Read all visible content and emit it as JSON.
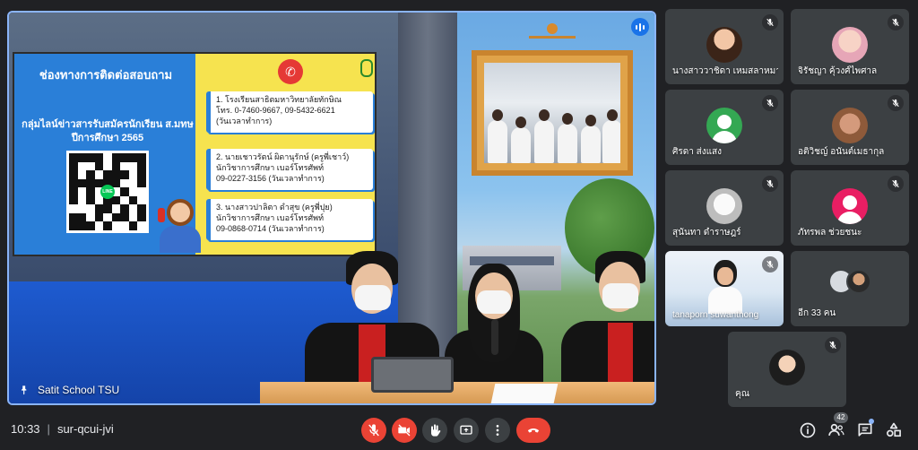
{
  "main_tile": {
    "name": "Satit School TSU",
    "poster": {
      "title": "ช่องทางการติดต่อสอบถาม",
      "subtitle": "กลุ่มไลน์ข่าวสารรับสมัครนักเรียน ส.มทษ ปีการศึกษา 2565",
      "contacts": [
        {
          "line1": "1. โรงเรียนสาธิตมหาวิทยาลัยทักษิณ",
          "line2": "โทร. 0-7460-9667, 09-5432-6621",
          "line3": "(วันเวลาทำการ)"
        },
        {
          "line1": "2. นายเชาวรัตน์ ผิดานุรักษ์ (ครูพี่เชาว์)",
          "line2": "นักวิชาการศึกษา เบอร์โทรศัพท์",
          "line3": "09-0227-3156 (วันเวลาทำการ)"
        },
        {
          "line1": "3. นางสาวปาลิตา ดำสุข (ครูพี่ปุย)",
          "line2": "นักวิชาการศึกษา เบอร์โทรศัพท์",
          "line3": "09-0868-0714 (วันเวลาทำการ)"
        }
      ]
    }
  },
  "participants": [
    {
      "name": "นางสาววาชิดา เหมสลาหมาด",
      "avatar": "photo1",
      "muted": true
    },
    {
      "name": "จิรัชญา คุ้วงศ์ไพศาล",
      "avatar": "photo2",
      "muted": true
    },
    {
      "name": "ศิรดา ส่งแสง",
      "avatar": "green",
      "muted": true
    },
    {
      "name": "อติวิชญ์ อนันต์เมธากุล",
      "avatar": "photo3",
      "muted": true
    },
    {
      "name": "สุนันทา ดำราษฎร์",
      "avatar": "photo4",
      "muted": true
    },
    {
      "name": "ภัทรพล ช่วยชนะ",
      "avatar": "pink",
      "muted": true
    },
    {
      "name": "tanaporn suwanthong",
      "avatar": "video",
      "muted": true
    },
    {
      "name": "อีก 33 คน",
      "avatar": "group",
      "muted": false
    },
    {
      "name": "คุณ",
      "avatar": "photo5",
      "muted": true
    }
  ],
  "bottombar": {
    "time": "10:33",
    "separator": "|",
    "meeting_code": "sur-qcui-jvi",
    "people_count": "42"
  },
  "colors": {
    "accent": "#8ab4f8",
    "danger": "#ea4335",
    "tile": "#3c4043",
    "background": "#202124"
  }
}
